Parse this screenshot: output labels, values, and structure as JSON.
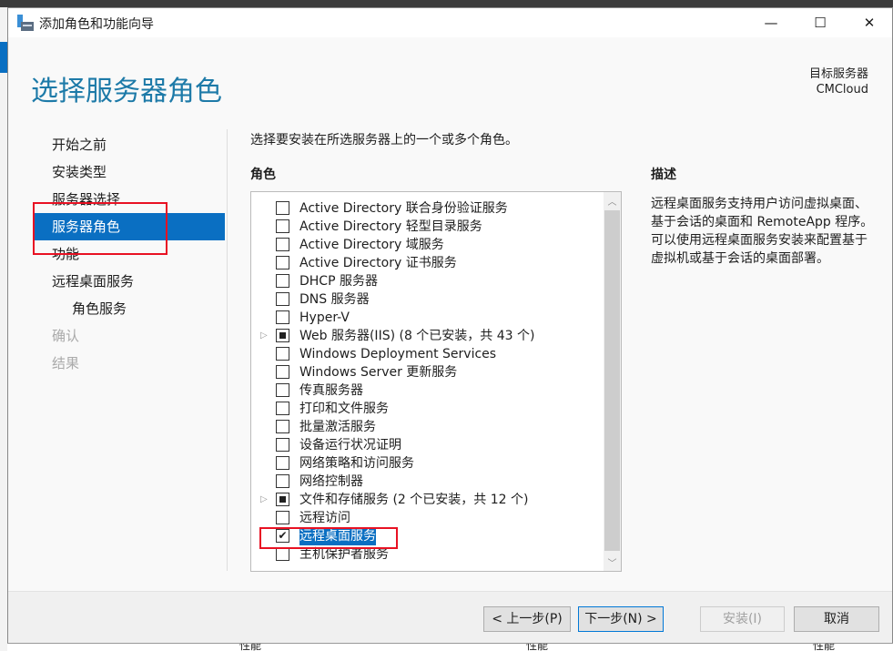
{
  "window": {
    "title": "添加角色和功能向导",
    "minimize": "—",
    "maximize": "☐",
    "close": "✕"
  },
  "page_title": "选择服务器角色",
  "target_server": {
    "label": "目标服务器",
    "name": "CMCloud"
  },
  "nav": [
    {
      "label": "开始之前",
      "state": "normal"
    },
    {
      "label": "安装类型",
      "state": "normal"
    },
    {
      "label": "服务器选择",
      "state": "normal"
    },
    {
      "label": "服务器角色",
      "state": "active"
    },
    {
      "label": "功能",
      "state": "normal"
    },
    {
      "label": "远程桌面服务",
      "state": "normal"
    },
    {
      "label": "角色服务",
      "state": "sub"
    },
    {
      "label": "确认",
      "state": "disabled"
    },
    {
      "label": "结果",
      "state": "disabled"
    }
  ],
  "intro": "选择要安装在所选服务器上的一个或多个角色。",
  "roles_label": "角色",
  "description_label": "描述",
  "description": "远程桌面服务支持用户访问虚拟桌面、基于会话的桌面和 RemoteApp 程序。可以使用远程桌面服务安装来配置基于虚拟机或基于会话的桌面部署。",
  "roles": [
    {
      "label": "Active Directory 联合身份验证服务",
      "state": "unchecked"
    },
    {
      "label": "Active Directory 轻型目录服务",
      "state": "unchecked"
    },
    {
      "label": "Active Directory 域服务",
      "state": "unchecked"
    },
    {
      "label": "Active Directory 证书服务",
      "state": "unchecked"
    },
    {
      "label": "DHCP 服务器",
      "state": "unchecked"
    },
    {
      "label": "DNS 服务器",
      "state": "unchecked"
    },
    {
      "label": "Hyper-V",
      "state": "unchecked"
    },
    {
      "label": "Web 服务器(IIS) (8 个已安装，共 43 个)",
      "state": "partial",
      "expandable": true
    },
    {
      "label": "Windows Deployment Services",
      "state": "unchecked"
    },
    {
      "label": "Windows Server 更新服务",
      "state": "unchecked"
    },
    {
      "label": "传真服务器",
      "state": "unchecked"
    },
    {
      "label": "打印和文件服务",
      "state": "unchecked"
    },
    {
      "label": "批量激活服务",
      "state": "unchecked"
    },
    {
      "label": "设备运行状况证明",
      "state": "unchecked"
    },
    {
      "label": "网络策略和访问服务",
      "state": "unchecked"
    },
    {
      "label": "网络控制器",
      "state": "unchecked"
    },
    {
      "label": "文件和存储服务 (2 个已安装，共 12 个)",
      "state": "partial",
      "expandable": true
    },
    {
      "label": "远程访问",
      "state": "unchecked"
    },
    {
      "label": "远程桌面服务",
      "state": "checked",
      "selected": true
    },
    {
      "label": "主机保护者服务",
      "state": "unchecked"
    }
  ],
  "buttons": {
    "prev": "< 上一步(P)",
    "next": "下一步(N) >",
    "install": "安装(I)",
    "cancel": "取消"
  },
  "background": {
    "bottom_labels": [
      "性能",
      "性能",
      "性能"
    ]
  },
  "colors": {
    "accent": "#0a6fc2",
    "title": "#1d7aa8",
    "highlight": "#e81123"
  }
}
